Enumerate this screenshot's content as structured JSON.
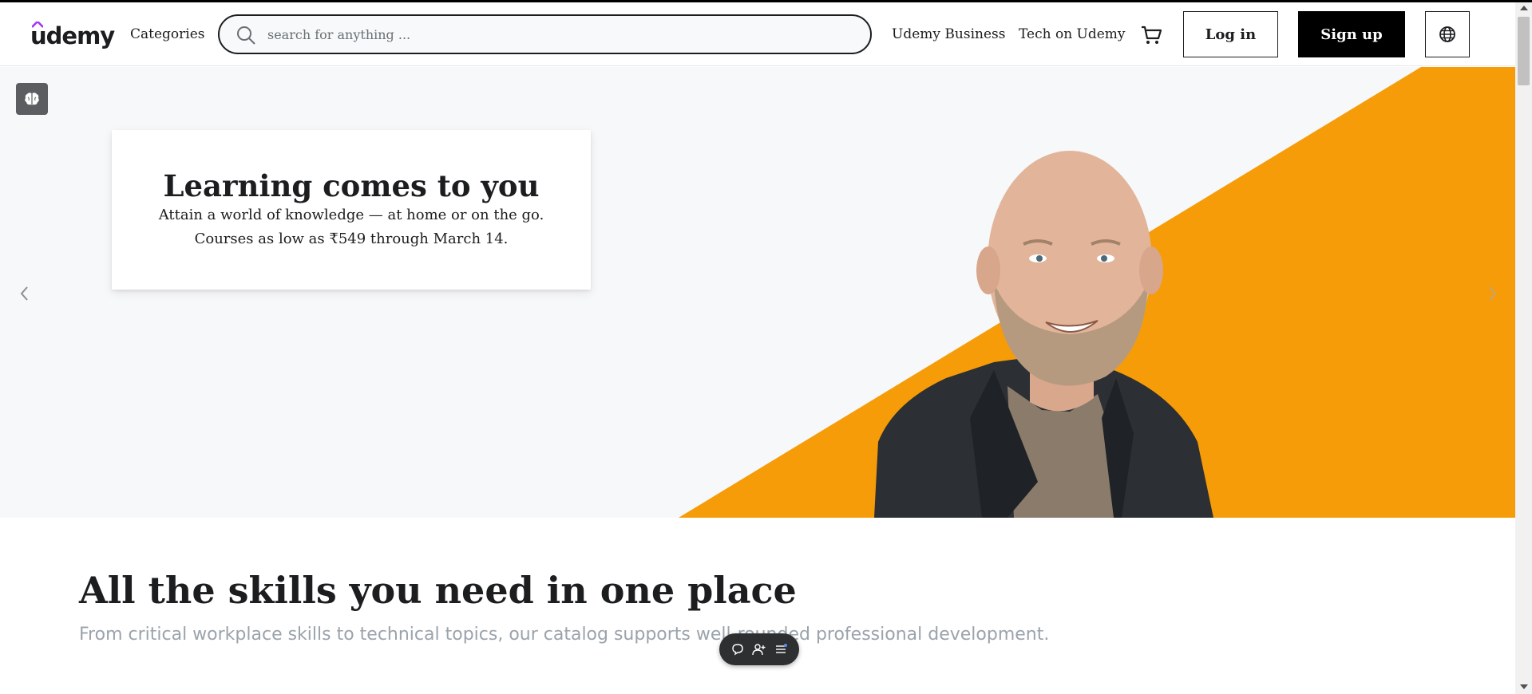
{
  "header": {
    "logo_text": "udemy",
    "categories_label": "Categories",
    "search_placeholder": "search for anything ...",
    "nav_business": "Udemy Business",
    "nav_teach": "Tech on Udemy",
    "login_label": "Log in",
    "signup_label": "Sign up"
  },
  "hero": {
    "title": "Learning comes to you",
    "subtitle": "Attain a world of knowledge — at home or on the go. Courses as low as ₹549 through March 14."
  },
  "skills": {
    "title": "All the skills you need in one place",
    "subtitle": "From critical workplace skills to technical topics, our catalog supports well-rounded professional development."
  },
  "colors": {
    "brand_purple": "#a435f0",
    "accent_orange": "#f69c08",
    "hero_bg": "#f7f8fa",
    "text_dark": "#1c1d1f",
    "muted": "#9ba3ab"
  },
  "icons": {
    "search": "search-icon",
    "cart": "cart-icon",
    "language": "globe-icon",
    "brain": "brain-icon",
    "prev": "chevron-left-icon",
    "next": "chevron-right-icon",
    "chat": "chat-icon",
    "add_user": "add-user-icon",
    "list": "list-icon"
  }
}
